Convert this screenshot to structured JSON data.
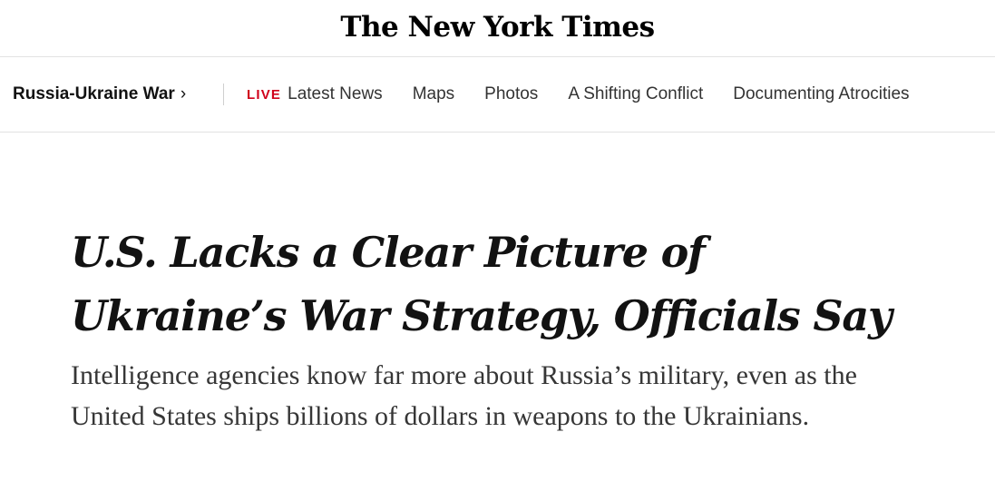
{
  "masthead": {
    "logo_text": "The New York Times"
  },
  "section_nav": {
    "section_label": "Russia-Ukraine War",
    "chevron": "›",
    "live_label": "LIVE",
    "items": [
      {
        "label": "Latest News"
      },
      {
        "label": "Maps"
      },
      {
        "label": "Photos"
      },
      {
        "label": "A Shifting Conflict"
      },
      {
        "label": "Documenting Atrocities"
      }
    ]
  },
  "article": {
    "headline": "U.S. Lacks a Clear Picture of Ukraine’s War Strategy, Officials Say",
    "summary": "Intelligence agencies know far more about Russia’s military, even as the United States ships billions of dollars in weapons to the Ukrainians."
  },
  "colors": {
    "live_red": "#d0021b",
    "text_dark": "#121212",
    "summary_gray": "#363636",
    "divider": "#e2e2e2"
  }
}
